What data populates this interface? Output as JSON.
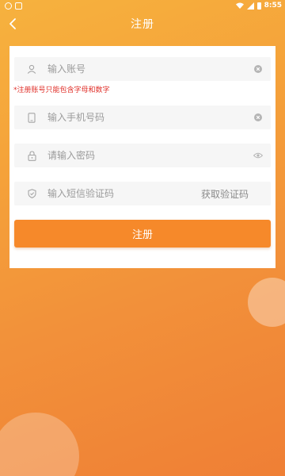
{
  "status_bar": {
    "time": "8:55",
    "icons": [
      "notification-icon",
      "app-icon",
      "wifi-icon",
      "signal-icon",
      "battery-icon"
    ]
  },
  "header": {
    "title": "注册",
    "back_icon": "chevron-left-icon"
  },
  "form": {
    "account": {
      "placeholder": "输入账号",
      "value": "",
      "icon": "user-icon",
      "action_icon": "clear-icon"
    },
    "account_hint": "*注册账号只能包含字母和数字",
    "phone": {
      "placeholder": "输入手机号码",
      "value": "",
      "icon": "phone-icon",
      "action_icon": "clear-icon"
    },
    "password": {
      "placeholder": "请输入密码",
      "value": "",
      "icon": "lock-icon",
      "action_icon": "eye-icon"
    },
    "sms_code": {
      "placeholder": "输入短信验证码",
      "value": "",
      "icon": "shield-icon",
      "action_label": "获取验证码"
    },
    "submit_label": "注册"
  },
  "colors": {
    "accent": "#f6892a",
    "hint": "#e0302a",
    "background_top": "#f6b23e",
    "background_bottom": "#ef7f35"
  }
}
